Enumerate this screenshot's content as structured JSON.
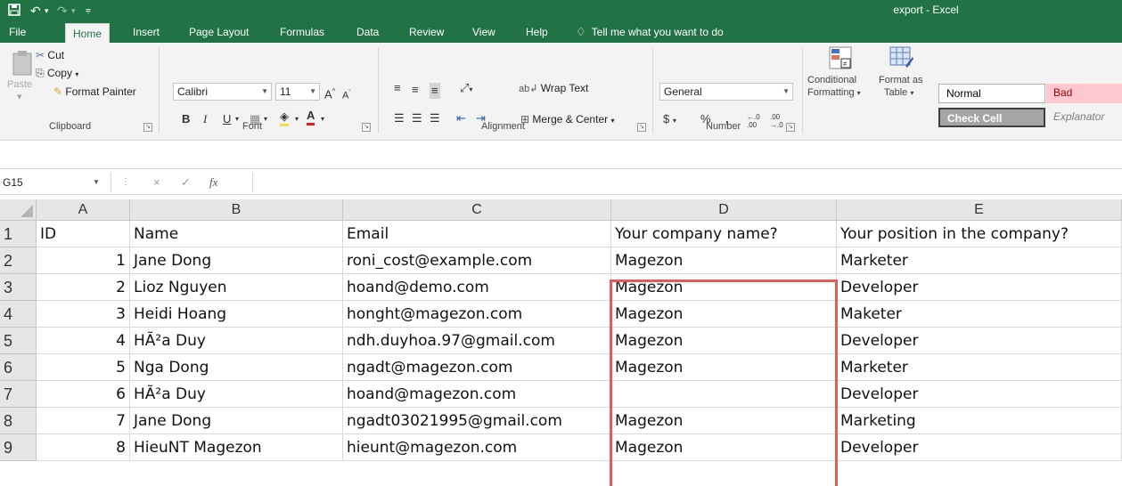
{
  "titlebar": {
    "title": "export  -  Excel",
    "save_icon": "save-icon",
    "undo_icon": "undo-icon",
    "redo_icon": "redo-icon",
    "customize_icon": "customize-quick-access-icon"
  },
  "menu": {
    "tabs": [
      "File",
      "Home",
      "Insert",
      "Page Layout",
      "Formulas",
      "Data",
      "Review",
      "View",
      "Help"
    ],
    "active_tab": "Home",
    "tell_me": "Tell me what you want to do"
  },
  "ribbon": {
    "clipboard": {
      "paste": "Paste",
      "cut": "Cut",
      "copy": "Copy",
      "format_painter": "Format Painter",
      "label": "Clipboard"
    },
    "font": {
      "name": "Calibri",
      "size": "11",
      "grow": "A",
      "shrink": "A",
      "bold": "B",
      "italic": "I",
      "underline": "U",
      "font_color": "A",
      "label": "Font"
    },
    "alignment": {
      "wrap_text": "Wrap Text",
      "merge_center": "Merge & Center",
      "label": "Alignment"
    },
    "number": {
      "format": "General",
      "currency": "$",
      "percent": "%",
      "comma": ",",
      "increase_decimal": "←.0  .00",
      "decrease_decimal": ".00  →.0",
      "label": "Number"
    },
    "styles": {
      "conditional_formatting": "Conditional",
      "conditional_formatting_2": "Formatting",
      "format_as_table": "Format as",
      "format_as_table_2": "Table",
      "normal": "Normal",
      "bad": "Bad",
      "check_cell": "Check Cell",
      "explanatory": "Explanator"
    }
  },
  "formula_bar": {
    "name_box": "G15",
    "cancel": "×",
    "enter": "✓",
    "fx": "fx",
    "value": ""
  },
  "sheet": {
    "columns": [
      "A",
      "B",
      "C",
      "D",
      "E"
    ],
    "row_numbers": [
      "1",
      "2",
      "3",
      "4",
      "5",
      "6",
      "7",
      "8",
      "9"
    ],
    "rows": [
      [
        "ID",
        "Name",
        "Email",
        "Your company name?",
        "Your position in the company?"
      ],
      [
        "1",
        "Jane Dong",
        "roni_cost@example.com",
        "Magezon",
        "Marketer"
      ],
      [
        "2",
        "Lioz Nguyen",
        "hoand@demo.com",
        "Magezon",
        "Developer"
      ],
      [
        "3",
        "Heidi Hoang",
        "honght@magezon.com",
        "Magezon",
        "Maketer"
      ],
      [
        "4",
        "HÃ²a Duy",
        "ndh.duyhoa.97@gmail.com",
        "Magezon",
        "Developer"
      ],
      [
        "5",
        "Nga Dong",
        "ngadt@magezon.com",
        "Magezon",
        "Marketer"
      ],
      [
        "6",
        "HÃ²a Duy",
        "hoand@magezon.com",
        "",
        "Developer"
      ],
      [
        "7",
        "Jane Dong",
        "ngadt03021995@gmail.com",
        "Magezon",
        "Marketing"
      ],
      [
        "8",
        "HieuNT Magezon",
        "hieunt@magezon.com",
        "Magezon",
        "Developer"
      ]
    ]
  }
}
